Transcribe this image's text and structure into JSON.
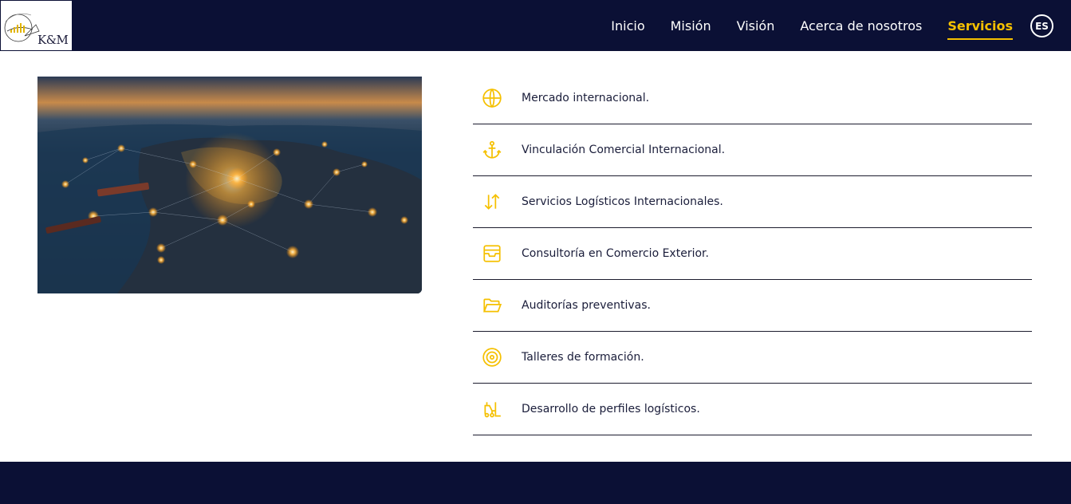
{
  "brand": {
    "logo_text": "K&M"
  },
  "colors": {
    "navy": "#0b1035",
    "accent": "#f5c000",
    "text": "#1a1d3a"
  },
  "nav": {
    "items": [
      {
        "label": "Inicio",
        "active": false
      },
      {
        "label": "Misión",
        "active": false
      },
      {
        "label": "Visión",
        "active": false
      },
      {
        "label": "Acerca de nosotros",
        "active": false
      },
      {
        "label": "Servicios",
        "active": true
      }
    ],
    "language": "ES"
  },
  "hero": {
    "image": "night-earth-europe-network-icon"
  },
  "services": [
    {
      "label": "Mercado internacional.",
      "icon": "globe-icon"
    },
    {
      "label": "Vinculación Comercial Internacional.",
      "icon": "anchor-icon"
    },
    {
      "label": "Servicios Logísticos Internacionales.",
      "icon": "arrows-up-down-icon"
    },
    {
      "label": "Consultoría en Comercio Exterior.",
      "icon": "inbox-icon"
    },
    {
      "label": "Auditorías preventivas.",
      "icon": "folder-open-icon"
    },
    {
      "label": "Talleres de formación.",
      "icon": "target-icon"
    },
    {
      "label": "Desarrollo de perfiles logísticos.",
      "icon": "forklift-icon"
    }
  ]
}
